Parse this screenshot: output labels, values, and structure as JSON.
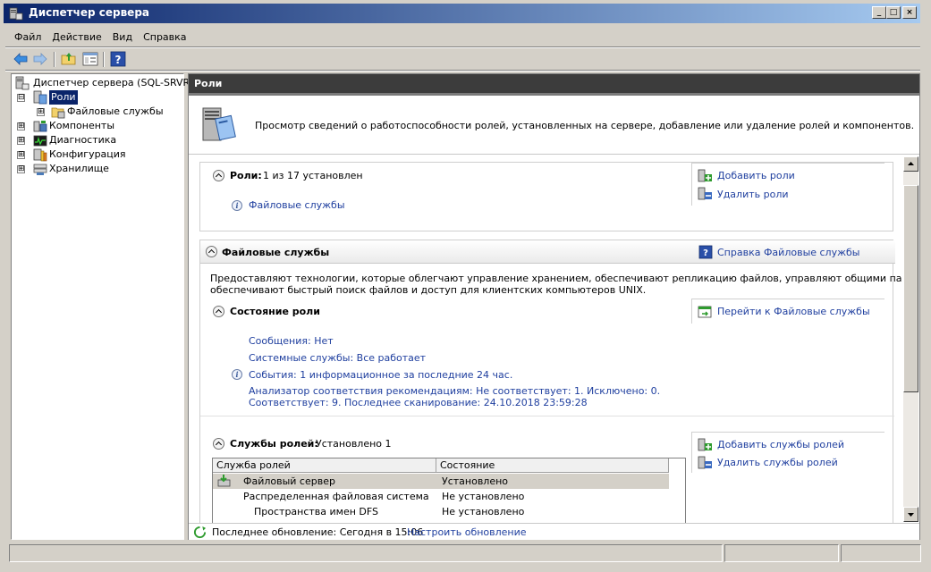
{
  "window": {
    "title": "Диспетчер сервера",
    "controls": {
      "minimize": "_",
      "maximize": "□",
      "close": "×"
    }
  },
  "menu": [
    "Файл",
    "Действие",
    "Вид",
    "Справка"
  ],
  "toolbar": {
    "icons": [
      "back-icon",
      "forward-icon",
      "up-folder-icon",
      "show-hide-tree-icon",
      "help-icon"
    ],
    "help_glyph": "?"
  },
  "tree": {
    "root": "Диспетчер сервера (SQL-SRVR)",
    "items": [
      {
        "label": "Роли",
        "expander": "⊟",
        "selected": true
      },
      {
        "label": "Файловые службы",
        "expander": "⊞"
      },
      {
        "label": "Компоненты",
        "expander": "⊞"
      },
      {
        "label": "Диагностика",
        "expander": "⊞"
      },
      {
        "label": "Конфигурация",
        "expander": "⊞"
      },
      {
        "label": "Хранилище",
        "expander": "⊞"
      }
    ]
  },
  "right": {
    "header": "Роли",
    "banner_text": "Просмотр сведений о работоспособности ролей, установленных на сервере, добавление или удаление ролей и компонентов.",
    "roles_section": {
      "title": "Роли:",
      "summary": "1 из 17 установлен",
      "installed_role": "Файловые службы",
      "actions": [
        "Добавить роли",
        "Удалить роли"
      ]
    },
    "file_services": {
      "title": "Файловые службы",
      "help_link": "Справка Файловые службы",
      "description_line1": "Предоставляют технологии, которые облегчают управление хранением, обеспечивают репликацию файлов, управляют общими папками,",
      "description_line2": "обеспечивают быстрый поиск файлов и доступ для клиентских компьютеров UNIX.",
      "role_status": {
        "title": "Состояние роли",
        "goto_link": "Перейти к Файловые службы",
        "messages": "Сообщения: Нет",
        "system_services": "Системные службы: Все работает",
        "events": "События: 1 информационное за последние 24 час.",
        "analyzer_line1": "Анализатор соответствия рекомендациям: Не соответствует: 1. Исключено: 0.",
        "analyzer_line2": "Соответствует: 9. Последнее сканирование: 24.10.2018 23:59:28"
      },
      "role_services": {
        "title": "Службы ролей:",
        "summary": "Установлено 1",
        "actions": [
          "Добавить службы ролей",
          "Удалить службы ролей"
        ],
        "columns": [
          "Служба ролей",
          "Состояние"
        ],
        "rows": [
          {
            "service": "Файловый сервер",
            "state": "Установлено"
          },
          {
            "service": "Распределенная файловая система",
            "state": "Не установлено"
          },
          {
            "service": "Пространства имен DFS",
            "state": "Не установлено"
          }
        ]
      }
    },
    "footer": {
      "last_update": "Последнее обновление: Сегодня в 15:06",
      "configure_link": "Настроить обновление"
    }
  }
}
